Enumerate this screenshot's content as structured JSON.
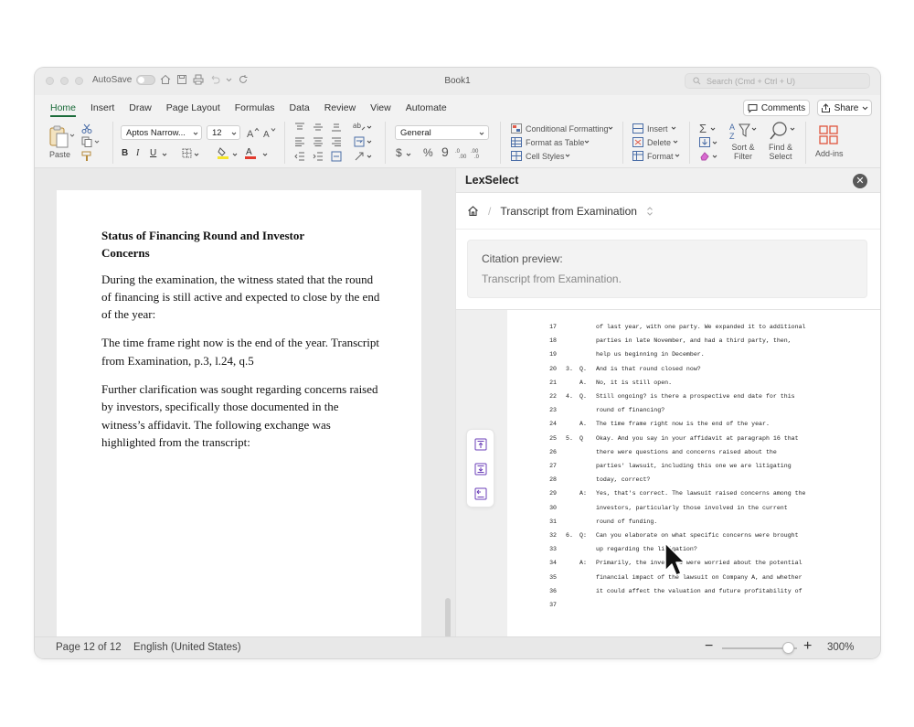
{
  "window": {
    "title": "Book1",
    "autosave_label": "AutoSave",
    "search_placeholder": "Search (Cmd + Ctrl + U)"
  },
  "tabs": [
    "Home",
    "Insert",
    "Draw",
    "Page Layout",
    "Formulas",
    "Data",
    "Review",
    "View",
    "Automate"
  ],
  "header_buttons": {
    "comments": "Comments",
    "share": "Share"
  },
  "ribbon": {
    "paste": "Paste",
    "font_name": "Aptos Narrow...",
    "font_size": "12",
    "number_format": "General",
    "conditional_formatting": "Conditional Formatting",
    "format_as_table": "Format as Table",
    "cell_styles": "Cell Styles",
    "insert": "Insert",
    "delete": "Delete",
    "format": "Format",
    "sort_filter": "Sort & Filter",
    "find_select": "Find & Select",
    "add_ins": "Add-ins"
  },
  "document": {
    "heading": "Status of Financing Round and Investor Concerns",
    "p1": "During the examination, the witness stated that the round of financing is still active and expected to close by the end of the year:",
    "p2": "The time frame right now is the end of the year. Transcript from Examination, p.3, l.24, q.5",
    "p3": "Further clarification was sought regarding concerns raised by investors, specifically those documented in the witness’s affidavit. The following exchange was highlighted from the transcript:"
  },
  "panel": {
    "title": "LexSelect",
    "breadcrumb": "Transcript from Examination",
    "citation_label": "Citation preview:",
    "citation_text": "Transcript from Examination."
  },
  "transcript": [
    {
      "line": "17",
      "num": "",
      "qa": "",
      "text": "of last year, with one party. We expanded it to additional"
    },
    {
      "line": "18",
      "num": "",
      "qa": "",
      "text": "parties in late November, and had a third party, then,"
    },
    {
      "line": "19",
      "num": "",
      "qa": "",
      "text": "help us beginning in December."
    },
    {
      "line": "20",
      "num": "3.",
      "qa": "Q.",
      "text": "And is that round closed now?"
    },
    {
      "line": "21",
      "num": "",
      "qa": "A.",
      "text": "No, it is still open."
    },
    {
      "line": "22",
      "num": "4.",
      "qa": "Q.",
      "text": "Still ongoing? is there a prospective end date for this"
    },
    {
      "line": "23",
      "num": "",
      "qa": "",
      "text": "round of financing?"
    },
    {
      "line": "24",
      "num": "",
      "qa": "A.",
      "text": "The time frame right now is the end of the year."
    },
    {
      "line": "25",
      "num": "5.",
      "qa": "Q",
      "text": "Okay. And you say in your affidavit at paragraph 16 that"
    },
    {
      "line": "26",
      "num": "",
      "qa": "",
      "text": "there were questions and concerns raised about the"
    },
    {
      "line": "27",
      "num": "",
      "qa": "",
      "text": "parties' lawsuit, including this one we are litigating"
    },
    {
      "line": "28",
      "num": "",
      "qa": "",
      "text": "today, correct?"
    },
    {
      "line": "29",
      "num": "",
      "qa": "A:",
      "text": "Yes, that's correct. The lawsuit raised concerns among the"
    },
    {
      "line": "30",
      "num": "",
      "qa": "",
      "text": "investors, particularly those involved in the current"
    },
    {
      "line": "31",
      "num": "",
      "qa": "",
      "text": "round of funding."
    },
    {
      "line": "32",
      "num": "6.",
      "qa": "Q:",
      "text": "Can you elaborate on what specific concerns were brought"
    },
    {
      "line": "33",
      "num": "",
      "qa": "",
      "text": "up regarding the litigation?"
    },
    {
      "line": "34",
      "num": "",
      "qa": "A:",
      "text": "Primarily, the investors were worried about the potential"
    },
    {
      "line": "35",
      "num": "",
      "qa": "",
      "text": "financial impact of the lawsuit on Company A, and whether"
    },
    {
      "line": "36",
      "num": "",
      "qa": "",
      "text": "it could affect the valuation and future profitability of"
    },
    {
      "line": "37",
      "num": "",
      "qa": "",
      "text": ""
    }
  ],
  "status": {
    "page": "Page 12 of 12",
    "language": "English (United States)",
    "zoom": "300%",
    "zoom_level": 0.88
  },
  "colors": {
    "accent": "#1b6b3a",
    "lex_purple": "#6b3fb8",
    "addins_red": "#e0553e"
  }
}
